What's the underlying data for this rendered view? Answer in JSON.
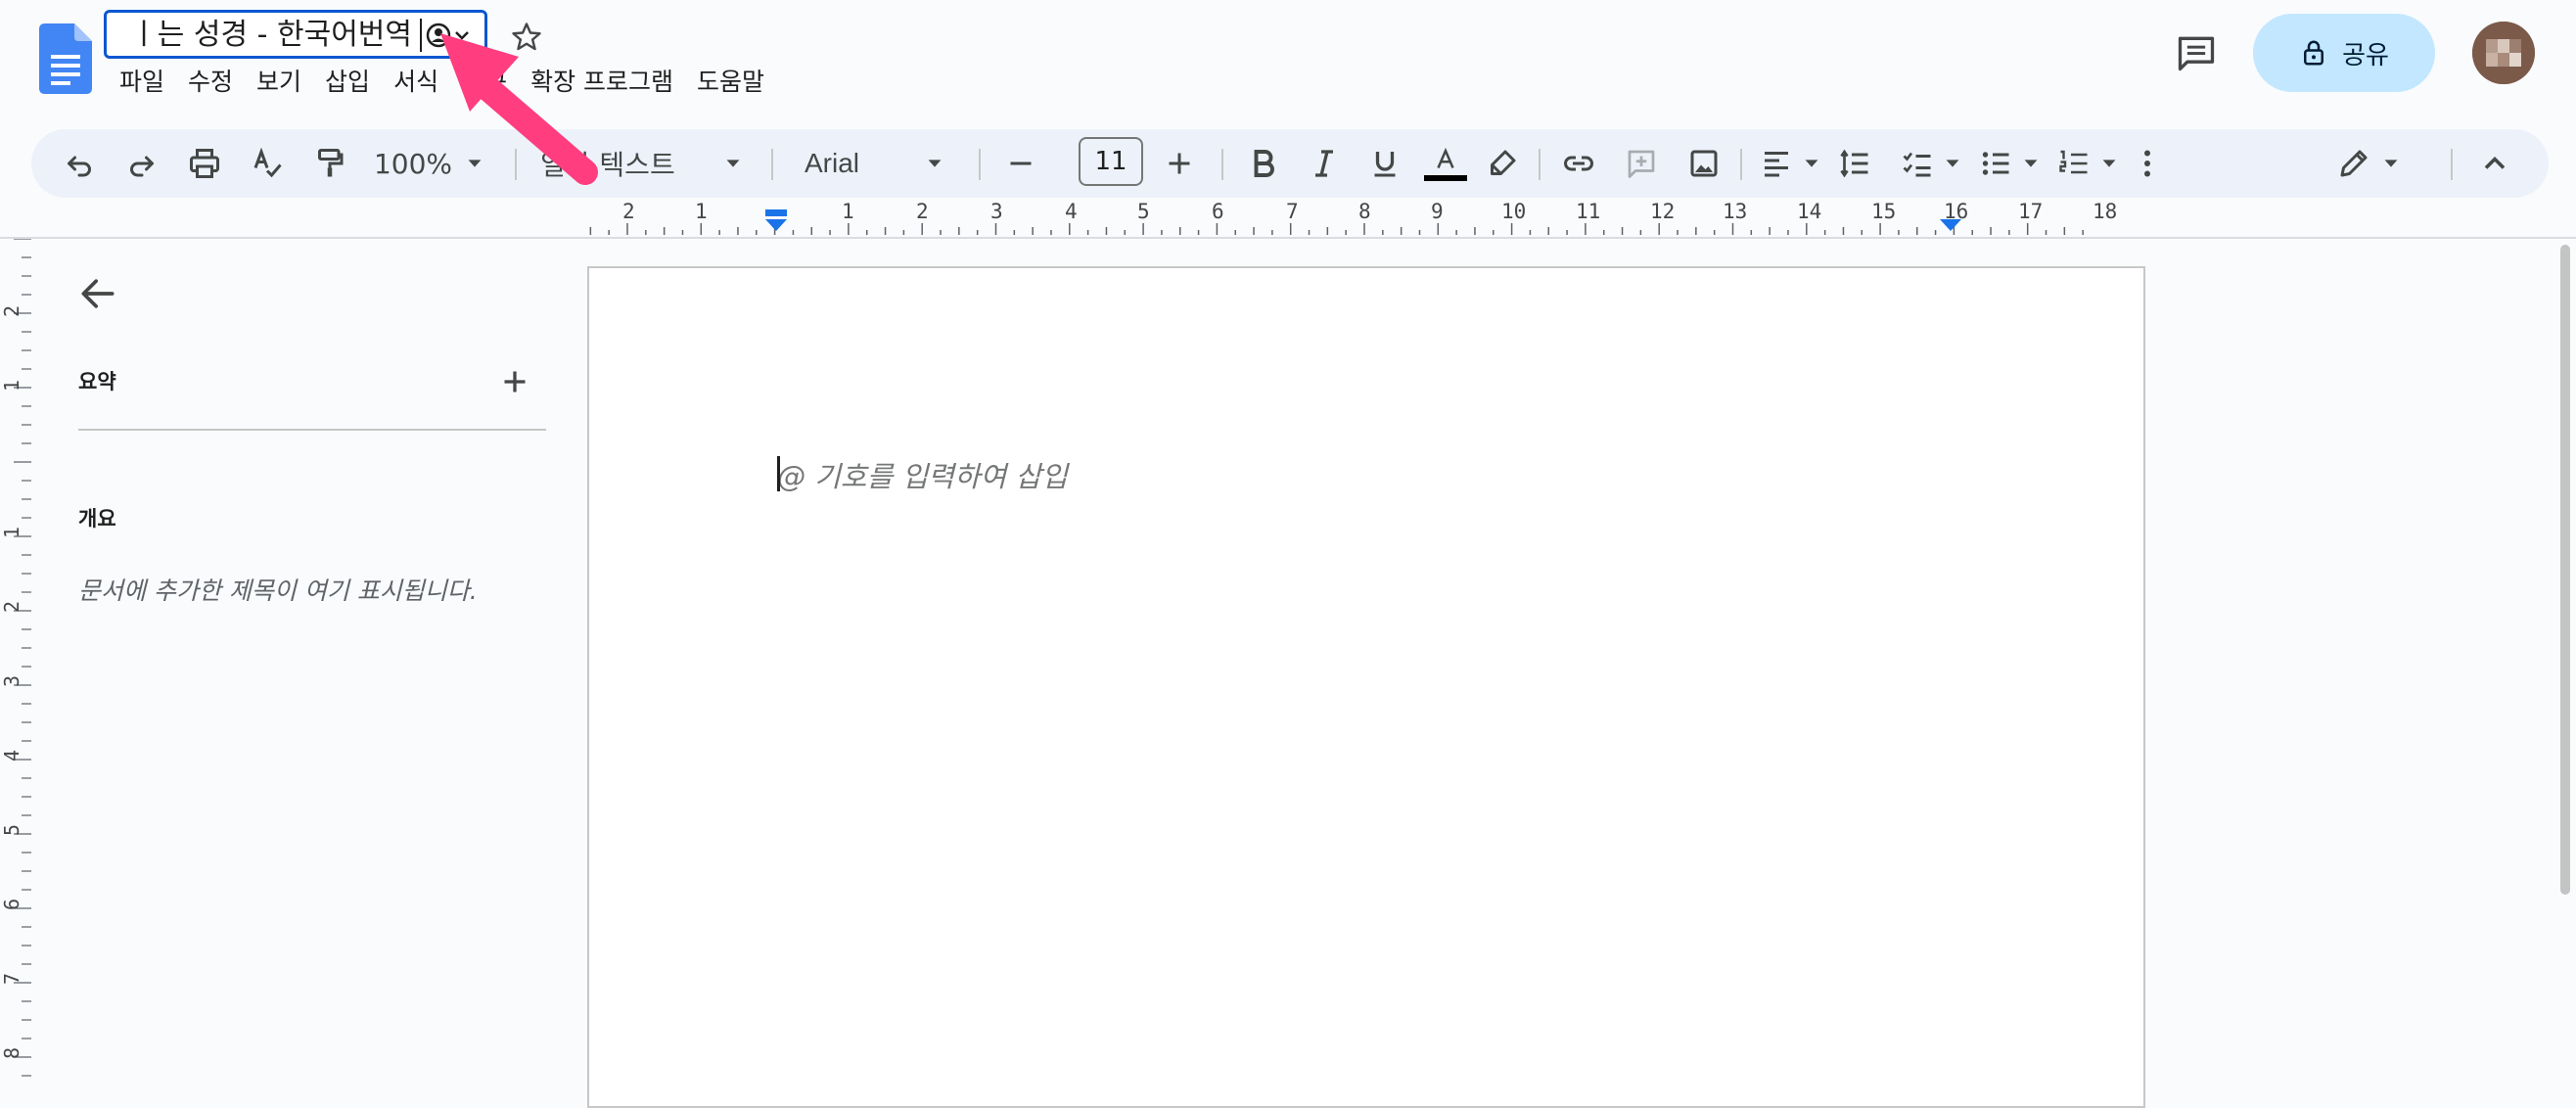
{
  "header": {
    "title_value": "ㅣ는 성경 - 한국어번역",
    "menu": [
      "파일",
      "수정",
      "보기",
      "삽입",
      "서식",
      "도구",
      "확장 프로그램",
      "도움말"
    ],
    "share_label": "공유"
  },
  "toolbar": {
    "zoom": "100%",
    "style": "일반 텍스트",
    "font": "Arial",
    "font_size": "11",
    "text_color": "#000000"
  },
  "ruler": {
    "labels": [
      "2",
      "1",
      "1",
      "2",
      "3",
      "4",
      "5",
      "6",
      "7",
      "8",
      "9",
      "10",
      "11",
      "12",
      "13",
      "14",
      "15",
      "16",
      "17",
      "18"
    ]
  },
  "vertical_ruler": {
    "labels": [
      "2",
      "1",
      "1",
      "2",
      "3",
      "4",
      "5",
      "6",
      "7",
      "8"
    ]
  },
  "outline_pane": {
    "summary_label": "요약",
    "outline_label": "개요",
    "outline_empty_text": "문서에 추가한 제목이 여기 표시됩니다."
  },
  "document": {
    "placeholder": "@ 기호를 입력하여 삽입"
  },
  "colors": {
    "accent": "#0b57d0",
    "share_bg": "#c2e7ff",
    "annotation_arrow": "#ff3d7f"
  }
}
